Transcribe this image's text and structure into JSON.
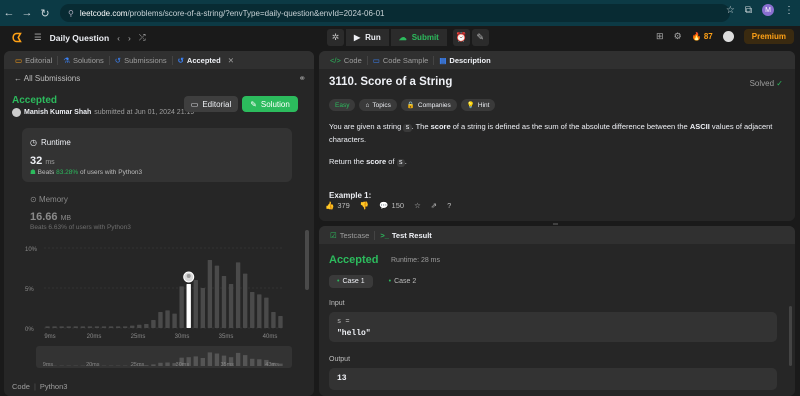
{
  "browser": {
    "url_domain": "leetcode.com",
    "url_path": "/problems/score-of-a-string/?envType=daily-question&envId=2024-06-01",
    "profile_letter": "M"
  },
  "topbar": {
    "daily_question": "Daily Question",
    "run": "Run",
    "submit": "Submit",
    "streak": "87",
    "premium": "Premium"
  },
  "left_tabs": [
    "Editorial",
    "Solutions",
    "Submissions",
    "Accepted"
  ],
  "submission": {
    "back_label": "All Submissions",
    "status": "Accepted",
    "user": "Manish Kumar Shah",
    "submitted_text": "submitted at Jun 01, 2024 21:19",
    "editorial_btn": "Editorial",
    "solution_btn": "Solution",
    "runtime_label": "Runtime",
    "runtime_value": "32",
    "runtime_unit": "ms",
    "runtime_beats_prefix": "Beats",
    "runtime_beats_pct": "83.28%",
    "runtime_beats_suffix": "of users with Python3",
    "memory_label": "Memory",
    "memory_value": "16.66",
    "memory_unit": "MB",
    "memory_beats": "Beats 6.63% of users with Python3",
    "code_label": "Code",
    "lang": "Python3"
  },
  "chart_data": {
    "type": "bar",
    "y_ticks": [
      "10%",
      "5%",
      "0%"
    ],
    "ylim": [
      0,
      10
    ],
    "x_ticks": [
      "9ms",
      "20ms",
      "25ms",
      "30ms",
      "35ms",
      "40ms"
    ],
    "values": [
      0.2,
      0.2,
      0.2,
      0.2,
      0.2,
      0.2,
      0.2,
      0.2,
      0.2,
      0.2,
      0.2,
      0.2,
      0.3,
      0.4,
      0.5,
      1.0,
      2.0,
      2.2,
      1.8,
      5.2,
      5.5,
      6.0,
      5.0,
      8.5,
      7.8,
      6.5,
      5.5,
      8.2,
      6.8,
      4.5,
      4.2,
      3.8,
      2.0,
      1.5
    ],
    "highlight_index": 20,
    "brush_x_ticks": [
      "9ms",
      "20ms",
      "25ms",
      "30ms",
      "35ms",
      "43ms"
    ]
  },
  "problem_tabs": [
    "Code",
    "Code Sample",
    "Description"
  ],
  "problem": {
    "title": "3110. Score of a String",
    "solved": "Solved",
    "chips": [
      "Easy",
      "Topics",
      "Companies",
      "Hint"
    ],
    "p1_a": "You are given a string ",
    "p1_code": "s",
    "p1_b": ". The ",
    "p1_bold1": "score",
    "p1_c": " of a string is defined as the sum of the absolute difference between the ",
    "p1_bold2": "ASCII",
    "p1_d": " values of adjacent characters.",
    "p2_a": "Return the ",
    "p2_bold": "score",
    "p2_b": " of ",
    "p2_code": "s",
    "p2_c": ".",
    "example": "Example 1:",
    "likes": "379",
    "comments": "150"
  },
  "result_tabs": [
    "Testcase",
    "Test Result"
  ],
  "result": {
    "status": "Accepted",
    "runtime": "Runtime: 28 ms",
    "case1": "Case 1",
    "case2": "Case 2",
    "input_label": "Input",
    "var_name": "s =",
    "input_value": "\"hello\"",
    "output_label": "Output",
    "output_value": "13"
  }
}
